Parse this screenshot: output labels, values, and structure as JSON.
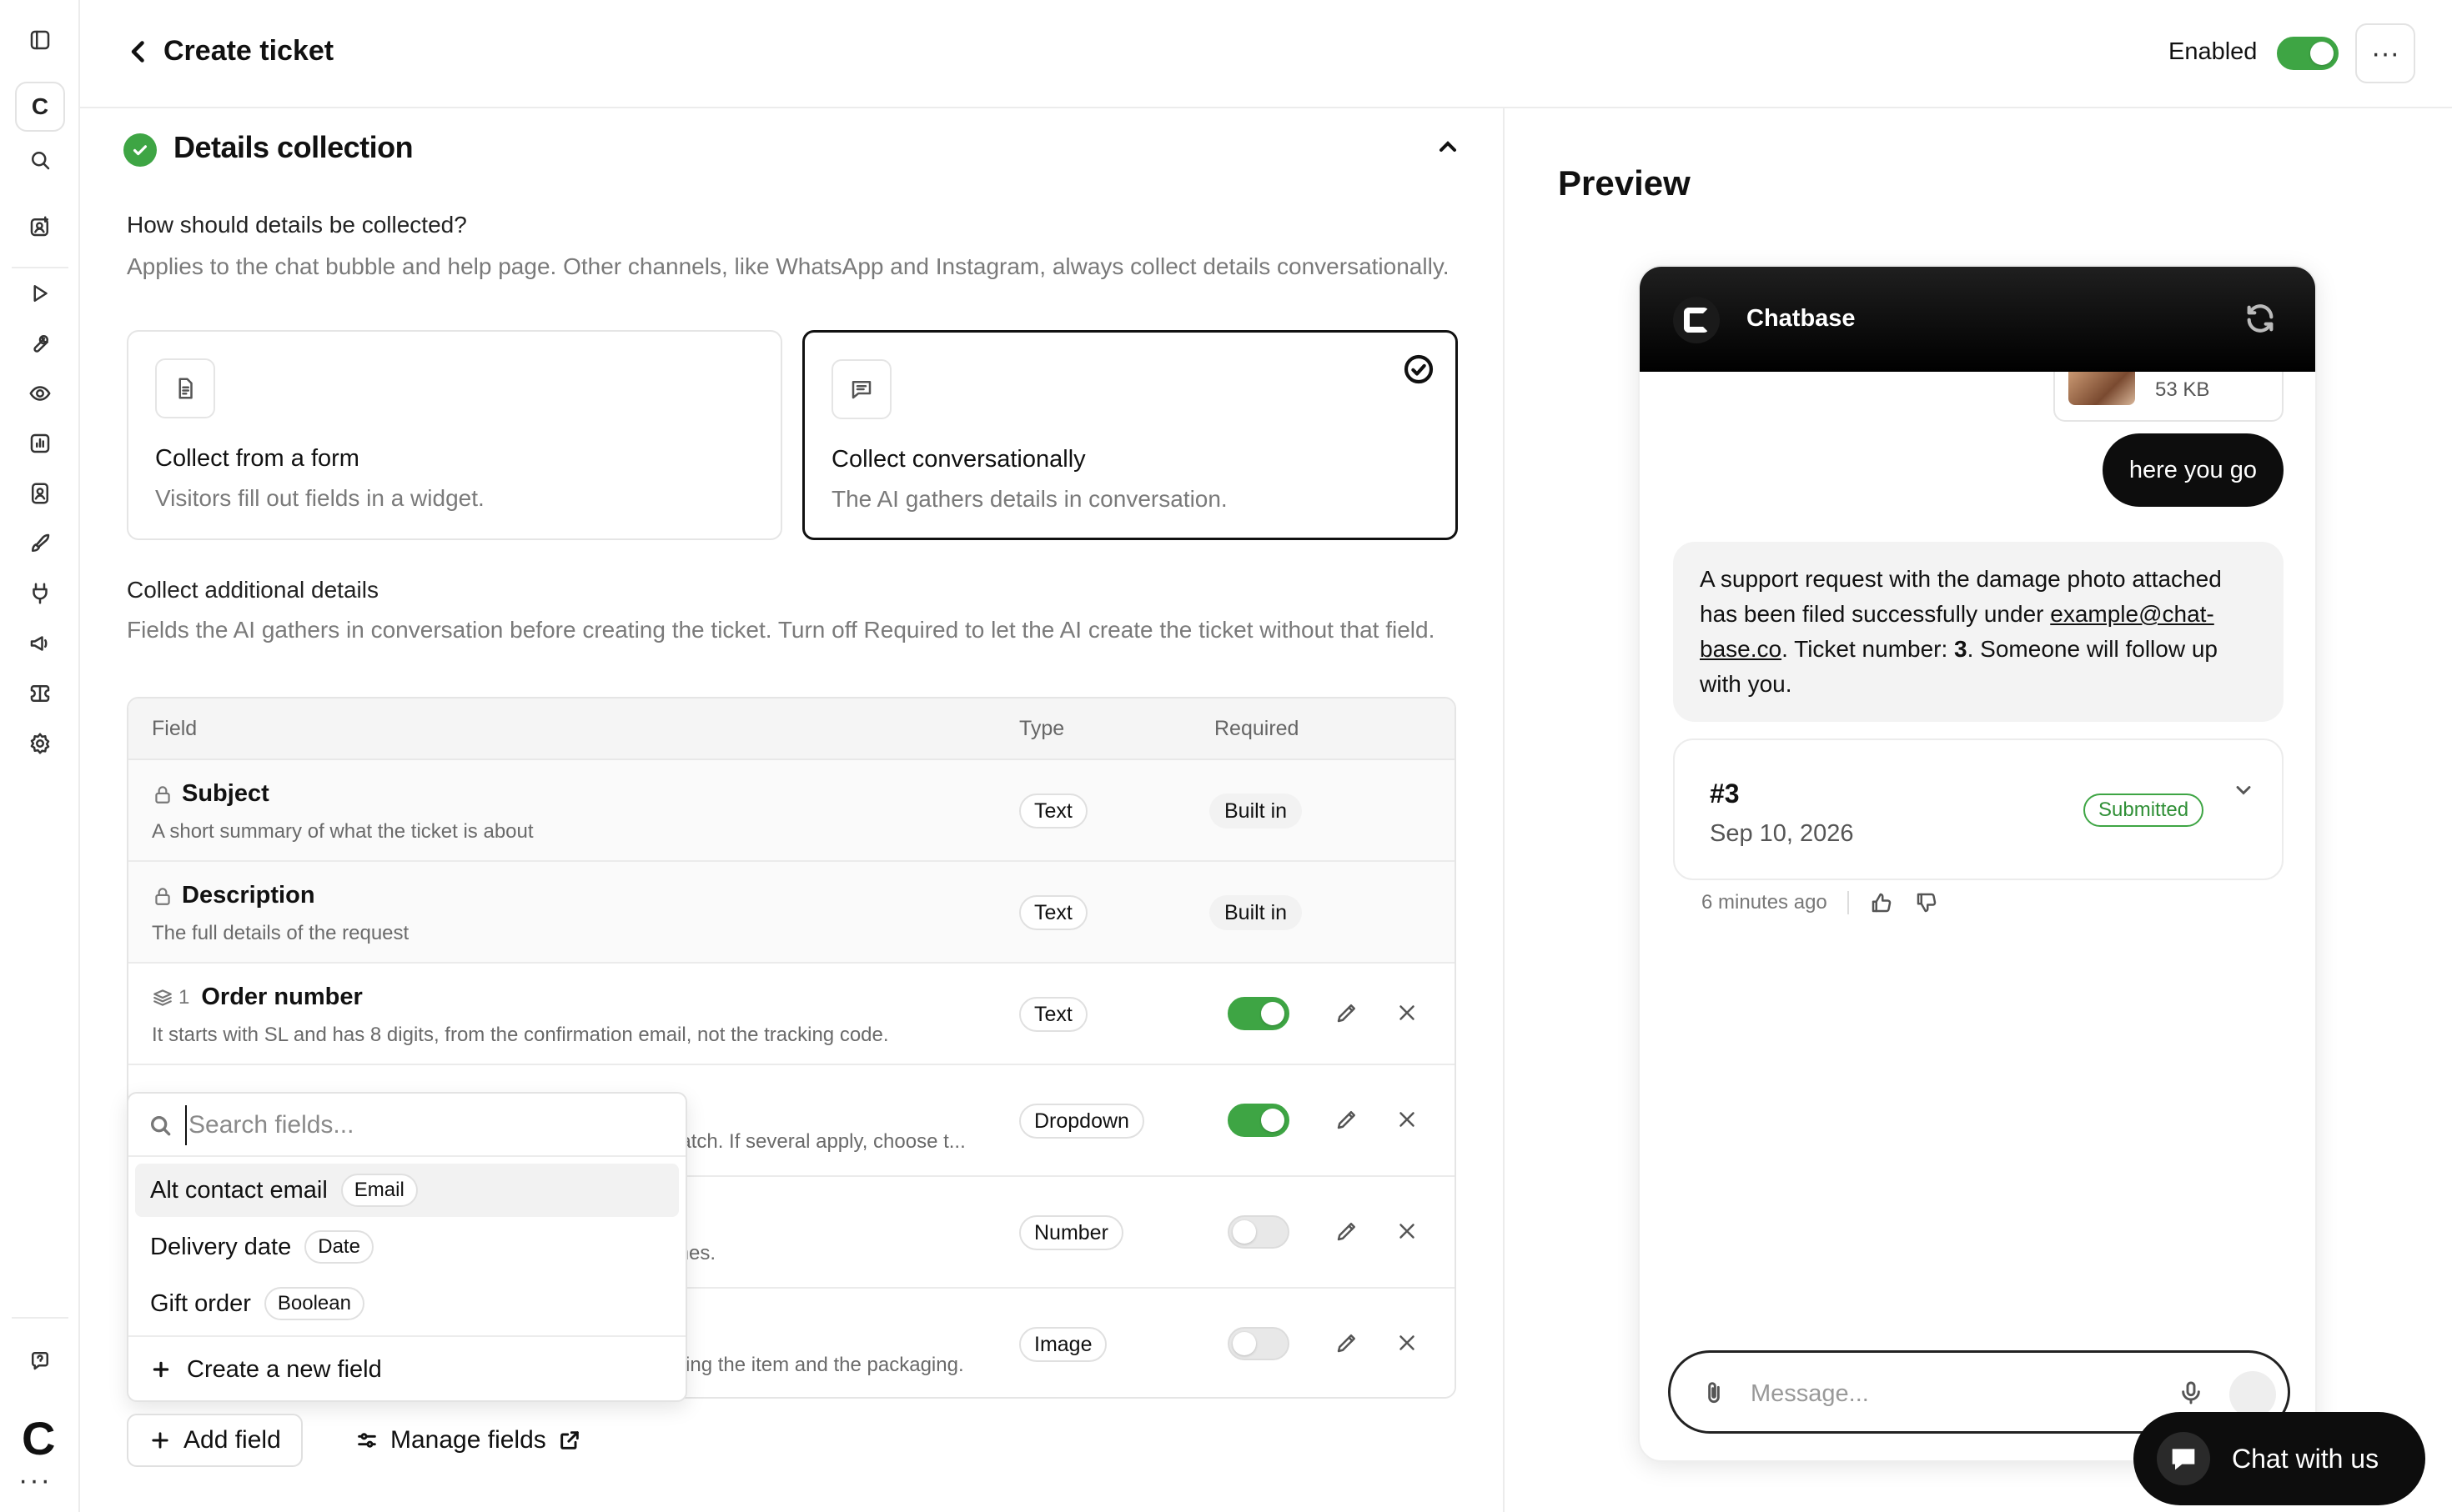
{
  "rail": {
    "workspace_initial": "C",
    "logo_letter": "C",
    "more": "···",
    "items": [
      "sidebar-toggle-icon",
      "search-icon",
      "agent-icon",
      "playground-icon",
      "tools-icon",
      "activity-icon",
      "analytics-icon",
      "contacts-icon",
      "deploy-icon",
      "integrations-icon",
      "announcements-icon",
      "tickets-icon",
      "settings-icon",
      "help-icon"
    ]
  },
  "header": {
    "title": "Create ticket",
    "enabled_label": "Enabled",
    "enabled": true,
    "more": "···"
  },
  "details": {
    "title": "Details collection",
    "question": "How should details be collected?",
    "question_desc": "Applies to the chat bubble and help page. Other channels, like WhatsApp and Instagram, always collect details conversationally.",
    "options": [
      {
        "title": "Collect from a form",
        "desc": "Visitors fill out fields in a widget.",
        "selected": false
      },
      {
        "title": "Collect conversationally",
        "desc": "The AI gathers details in conversation.",
        "selected": true
      }
    ],
    "additional_label": "Collect additional details",
    "additional_desc": "Fields the AI gathers in conversation before creating the ticket. Turn off Required to let the AI create the ticket without that field."
  },
  "table": {
    "headers": {
      "field": "Field",
      "type": "Type",
      "required": "Required"
    },
    "rows": [
      {
        "name": "Subject",
        "desc": "A short summary of what the ticket is about",
        "type": "Text",
        "required_label": "Built in",
        "locked": true
      },
      {
        "name": "Description",
        "desc": "The full details of the request",
        "type": "Text",
        "required_label": "Built in",
        "locked": true
      },
      {
        "name": "Order number",
        "index": "1",
        "desc": "It starts with SL and has 8 digits, from the confirmation email, not the tracking code.",
        "type": "Text",
        "required": true
      },
      {
        "desc": "losest match. If several apply, choose t...",
        "type": "Dropdown",
        "required": true
      },
      {
        "desc": "t order lines.",
        "type": "Number",
        "required": false
      },
      {
        "desc": "oto showing the item and the packaging.",
        "type": "Image",
        "required": false
      }
    ]
  },
  "dropdown": {
    "search_placeholder": "Search fields...",
    "items": [
      {
        "label": "Alt contact email",
        "tag": "Email"
      },
      {
        "label": "Delivery date",
        "tag": "Date"
      },
      {
        "label": "Gift order",
        "tag": "Boolean"
      }
    ],
    "create_label": "Create a new field"
  },
  "actions": {
    "add_field": "Add field",
    "manage_fields": "Manage fields"
  },
  "preview": {
    "title": "Preview",
    "bot_name": "Chatbase",
    "attachment_size": "53 KB",
    "user_message": "here you go",
    "bot_message_1": "A support request with the damage photo attached has been filed successfully under ",
    "bot_email": "example@chat-base.co",
    "bot_message_2": ". Ticket number: ",
    "bot_ticket_num": "3",
    "bot_message_3": ". Someone will follow up with you.",
    "ticket_number": "#3",
    "ticket_date": "Sep 10, 2026",
    "ticket_status": "Submitted",
    "timestamp": "6 minutes ago",
    "composer_placeholder": "Message...",
    "chat_button": "Chat with us"
  }
}
